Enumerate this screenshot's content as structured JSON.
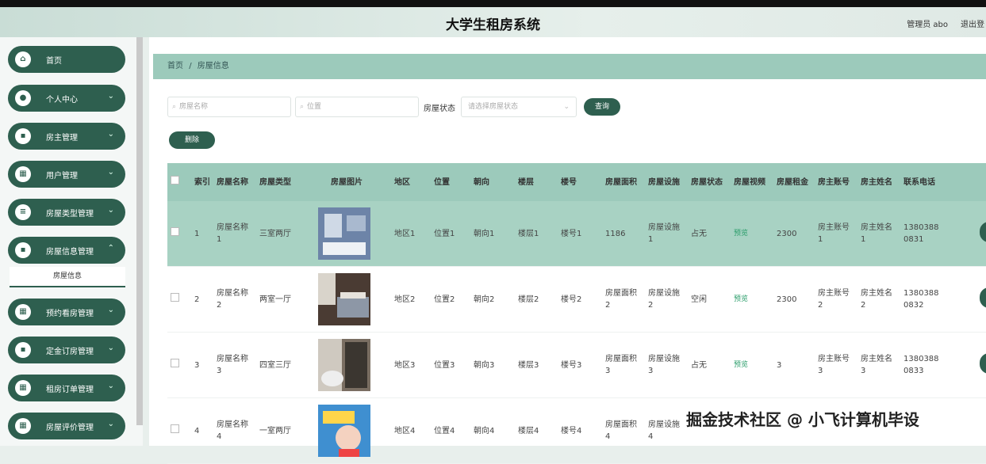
{
  "header": {
    "title": "大学生租房系统",
    "user": "管理员 abo",
    "logout": "退出登"
  },
  "sidebar": {
    "items": [
      {
        "label": "首页",
        "icon": "home-icon"
      },
      {
        "label": "个人中心",
        "icon": "user-icon"
      },
      {
        "label": "房主管理",
        "icon": "doc-icon"
      },
      {
        "label": "用户管理",
        "icon": "grid-icon"
      },
      {
        "label": "房屋类型管理",
        "icon": "list-icon"
      },
      {
        "label": "房屋信息管理",
        "icon": "doc-icon"
      },
      {
        "label": "预约看房管理",
        "icon": "grid-icon"
      },
      {
        "label": "定金订房管理",
        "icon": "doc-icon"
      },
      {
        "label": "租房订单管理",
        "icon": "grid-icon"
      },
      {
        "label": "房屋评价管理",
        "icon": "grid-icon"
      }
    ],
    "submenu": "房屋信息"
  },
  "breadcrumb": {
    "home": "首页",
    "sep": "/",
    "current": "房屋信息"
  },
  "search": {
    "name_placeholder": "房屋名称",
    "location_placeholder": "位置",
    "state_label": "房屋状态",
    "state_placeholder": "请选择房屋状态",
    "query_button": "查询",
    "delete_button": "删除"
  },
  "table": {
    "headers": [
      "索引",
      "房屋名称",
      "房屋类型",
      "房屋图片",
      "地区",
      "位置",
      "朝向",
      "楼层",
      "楼号",
      "房屋面积",
      "房屋设施",
      "房屋状态",
      "房屋视频",
      "房屋租金",
      "房主账号",
      "房主姓名",
      "联系电话"
    ],
    "rows": [
      {
        "index": "1",
        "name": "房屋名称1",
        "type": "三室两厅",
        "region": "地区1",
        "location": "位置1",
        "orientation": "朝向1",
        "floor": "楼层1",
        "building": "楼号1",
        "area": "1186",
        "facility": "房屋设施1",
        "state": "占无",
        "video": "预览",
        "rent": "2300",
        "owner_account": "房主账号1",
        "owner_name": "房主姓名1",
        "phone": "13803880831"
      },
      {
        "index": "2",
        "name": "房屋名称2",
        "type": "两室一厅",
        "region": "地区2",
        "location": "位置2",
        "orientation": "朝向2",
        "floor": "楼层2",
        "building": "楼号2",
        "area": "房屋面积2",
        "facility": "房屋设施2",
        "state": "空闲",
        "video": "预览",
        "rent": "2300",
        "owner_account": "房主账号2",
        "owner_name": "房主姓名2",
        "phone": "13803880832"
      },
      {
        "index": "3",
        "name": "房屋名称3",
        "type": "四室三厅",
        "region": "地区3",
        "location": "位置3",
        "orientation": "朝向3",
        "floor": "楼层3",
        "building": "楼号3",
        "area": "房屋面积3",
        "facility": "房屋设施3",
        "state": "占无",
        "video": "预览",
        "rent": "3",
        "owner_account": "房主账号3",
        "owner_name": "房主姓名3",
        "phone": "13803880833"
      },
      {
        "index": "4",
        "name": "房屋名称4",
        "type": "一室两厅",
        "region": "地区4",
        "location": "位置4",
        "orientation": "朝向4",
        "floor": "楼层4",
        "building": "楼号4",
        "area": "房屋面积4",
        "facility": "房屋设施4",
        "state": "",
        "video": "",
        "rent": "",
        "owner_account": "",
        "owner_name": "",
        "phone": ""
      }
    ]
  },
  "watermark": "掘金技术社区 @ 小飞计算机毕设",
  "colors": {
    "primary": "#2e5f4f",
    "header_row": "#9ccabb",
    "selected_row": "#a8d2c3"
  }
}
